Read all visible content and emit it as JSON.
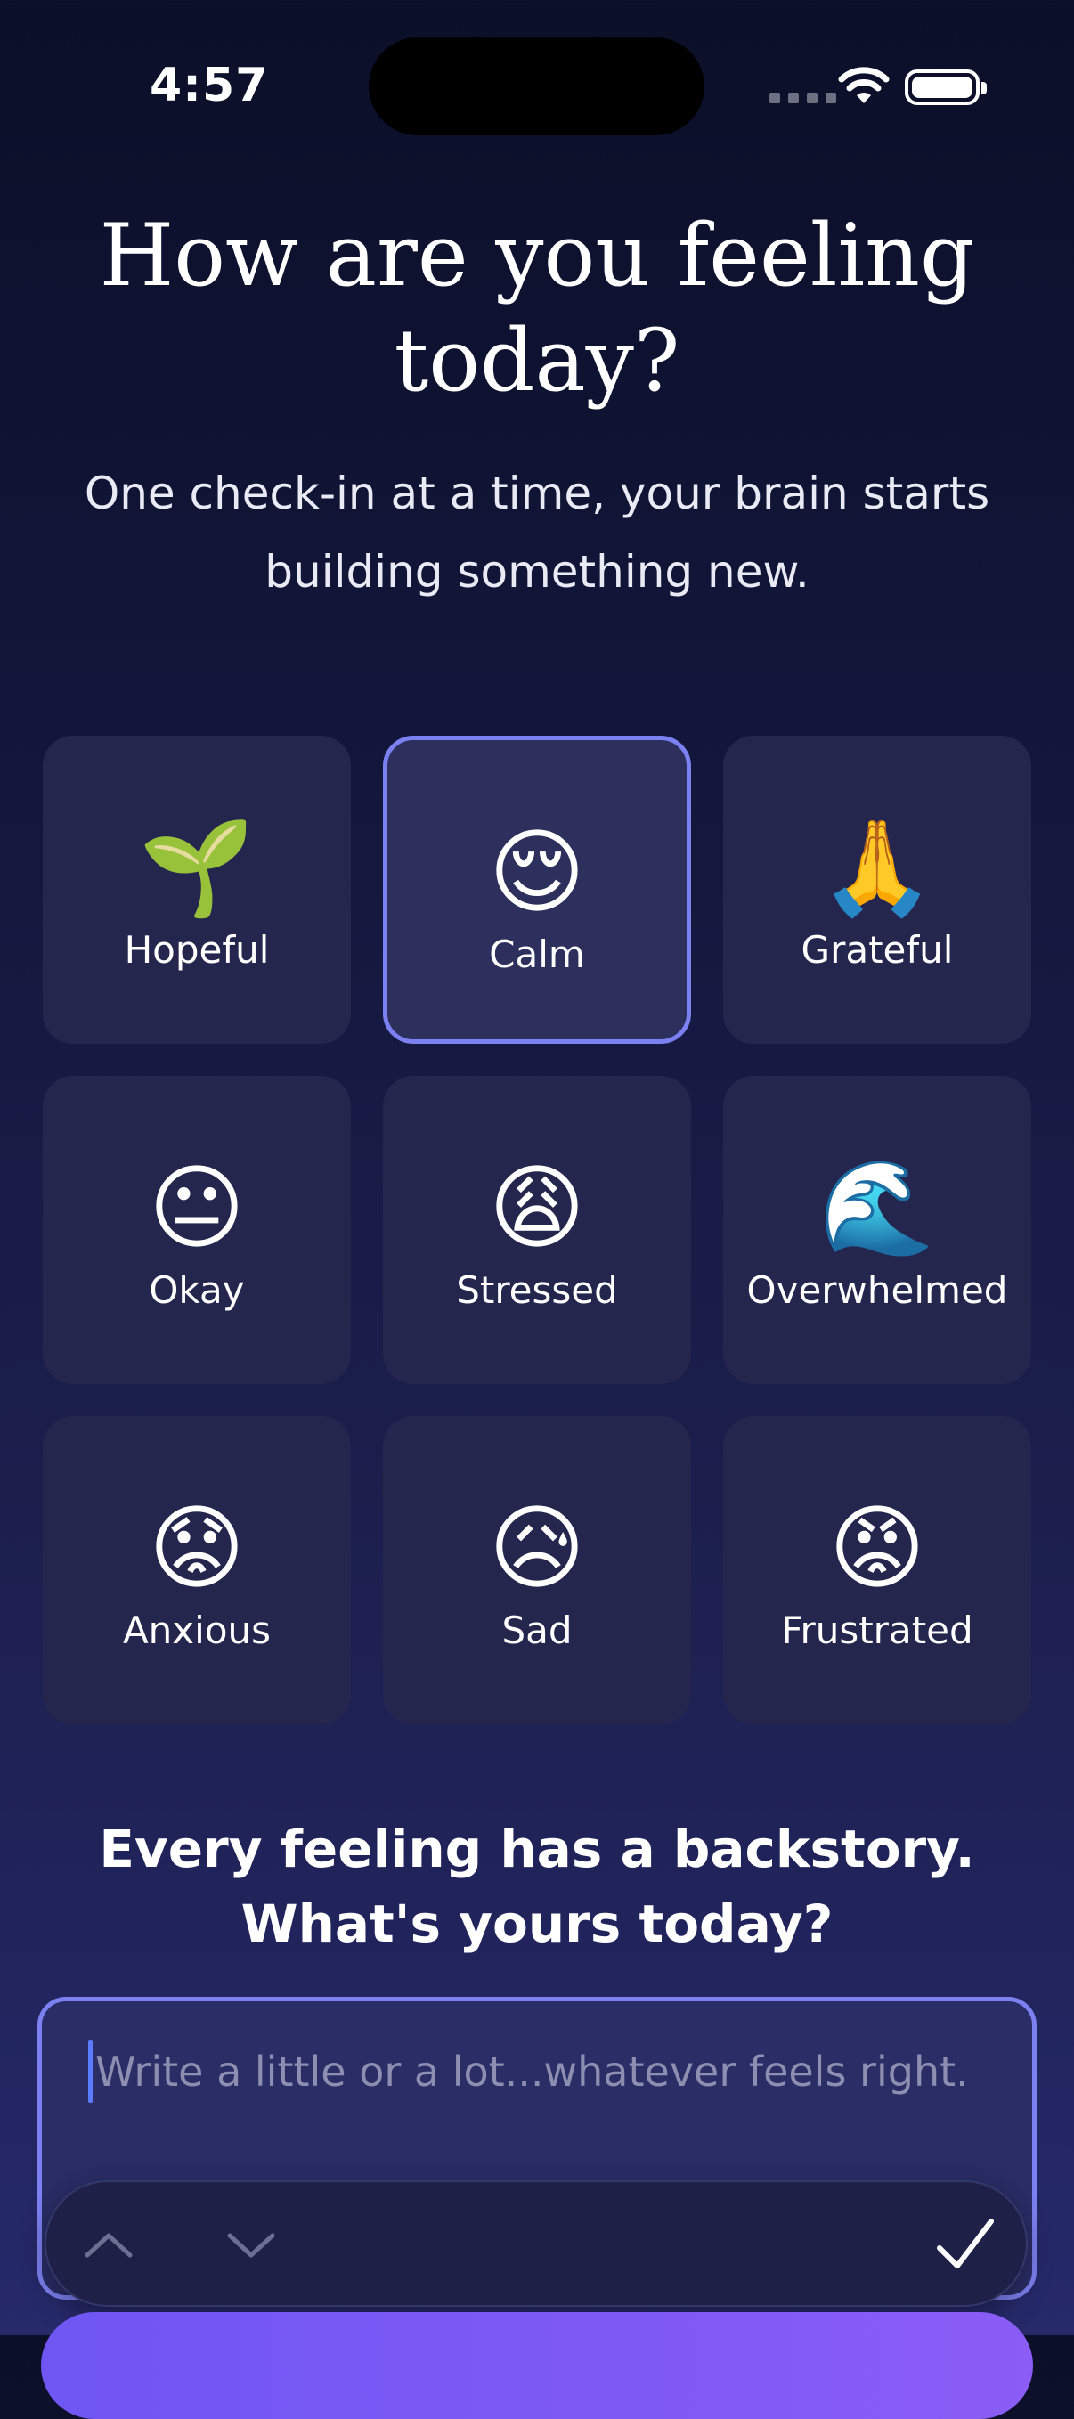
{
  "status_bar": {
    "time": "4:57"
  },
  "header": {
    "title": "How are you feeling today?",
    "subtitle": "One check-in at a time, your brain starts building something new."
  },
  "moods": [
    {
      "emoji": "🌱",
      "label": "Hopeful",
      "selected": false
    },
    {
      "emoji": "😌",
      "label": "Calm",
      "selected": true
    },
    {
      "emoji": "🙏",
      "label": "Grateful",
      "selected": false
    },
    {
      "emoji": "😐",
      "label": "Okay",
      "selected": false
    },
    {
      "emoji": "😩",
      "label": "Stressed",
      "selected": false
    },
    {
      "emoji": "🌊",
      "label": "Overwhelmed",
      "selected": false
    },
    {
      "emoji": "😟",
      "label": "Anxious",
      "selected": false
    },
    {
      "emoji": "😥",
      "label": "Sad",
      "selected": false
    },
    {
      "emoji": "😡",
      "label": "Frustrated",
      "selected": false
    }
  ],
  "journal": {
    "prompt": "Every feeling has a backstory. What's yours today?",
    "placeholder": "Write a little or a lot...whatever feels right.",
    "value": ""
  },
  "colors": {
    "accent": "#7b81f0",
    "card": "#24264e",
    "background_top": "#0b0f28",
    "background_bottom": "#26296a"
  }
}
